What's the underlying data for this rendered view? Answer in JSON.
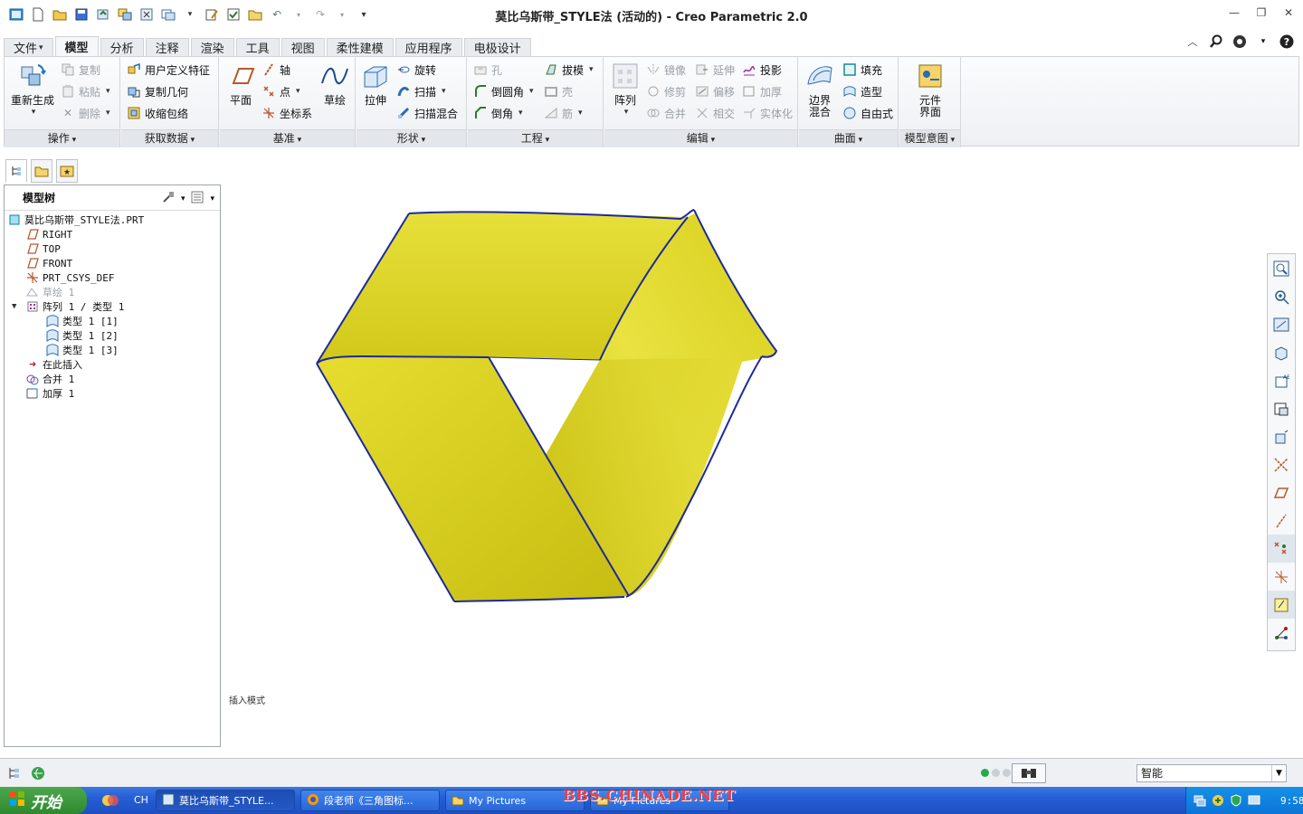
{
  "window": {
    "title": "莫比乌斯带_STYLE法 (活动的) - Creo Parametric 2.0"
  },
  "tabs": [
    "文件",
    "模型",
    "分析",
    "注释",
    "渲染",
    "工具",
    "视图",
    "柔性建模",
    "应用程序",
    "电极设计"
  ],
  "active_tab": "模型",
  "ribbon": {
    "operations": {
      "label": "操作",
      "regenerate": "重新生成",
      "copy": "复制",
      "paste": "粘贴",
      "delete": "删除"
    },
    "get_data": {
      "label": "获取数据",
      "udf": "用户定义特征",
      "copy_geom": "复制几何",
      "shrinkwrap": "收缩包络"
    },
    "datum": {
      "label": "基准",
      "plane": "平面",
      "axis": "轴",
      "point": "点",
      "csys": "坐标系",
      "sketch": "草绘"
    },
    "shapes": {
      "label": "形状",
      "extrude": "拉伸",
      "revolve": "旋转",
      "sweep": "扫描",
      "swept_blend": "扫描混合"
    },
    "engineering": {
      "label": "工程",
      "hole": "孔",
      "round": "倒圆角",
      "chamfer": "倒角",
      "draft": "拔模",
      "shell": "壳",
      "rib": "筋"
    },
    "editing": {
      "label": "编辑",
      "pattern": "阵列",
      "mirror": "镜像",
      "trim": "修剪",
      "merge": "合并",
      "extend": "延伸",
      "offset": "偏移",
      "intersect": "相交",
      "project": "投影",
      "thicken": "加厚",
      "solidify": "实体化"
    },
    "surfaces": {
      "label": "曲面",
      "boundary_blend_1": "边界",
      "boundary_blend_2": "混合",
      "fill": "填充",
      "style": "造型",
      "freestyle": "自由式"
    },
    "model_intent": {
      "label": "模型意图",
      "component_interface_1": "元件",
      "component_interface_2": "界面"
    }
  },
  "model_tree": {
    "title": "模型树",
    "nodes": [
      {
        "label": "莫比乌斯带_STYLE法.PRT",
        "icon": "part-icon"
      },
      {
        "label": "RIGHT",
        "icon": "datum-plane-icon"
      },
      {
        "label": "TOP",
        "icon": "datum-plane-icon"
      },
      {
        "label": "FRONT",
        "icon": "datum-plane-icon"
      },
      {
        "label": "PRT_CSYS_DEF",
        "icon": "csys-icon"
      },
      {
        "label": "草绘 1",
        "icon": "sketch-icon"
      },
      {
        "label": "阵列 1 / 类型 1",
        "icon": "pattern-icon"
      },
      {
        "label": "类型 1 [1]",
        "icon": "style-icon"
      },
      {
        "label": "类型 1 [2]",
        "icon": "style-icon"
      },
      {
        "label": "类型 1 [3]",
        "icon": "style-icon"
      },
      {
        "label": "在此插入",
        "icon": "insert-arrow-icon"
      },
      {
        "label": "合并 1",
        "icon": "merge-icon"
      },
      {
        "label": "加厚 1",
        "icon": "thicken-icon"
      }
    ]
  },
  "graphics": {
    "insert_mode": "插入模式"
  },
  "status": {
    "filter_value": "智能"
  },
  "taskbar": {
    "start": "开始",
    "lang": "CH",
    "items": [
      "莫比乌斯带_STYLE...",
      "段老师《三角图标...",
      "My Pictures",
      "My Pictures"
    ],
    "clock": "9:58"
  },
  "watermark": "BBS.CHINADE.NET",
  "colors": {
    "surface_yellow": "#d8cf1e",
    "edge_blue": "#1c2a9c",
    "ribbon_bg": "#eef0f3"
  }
}
